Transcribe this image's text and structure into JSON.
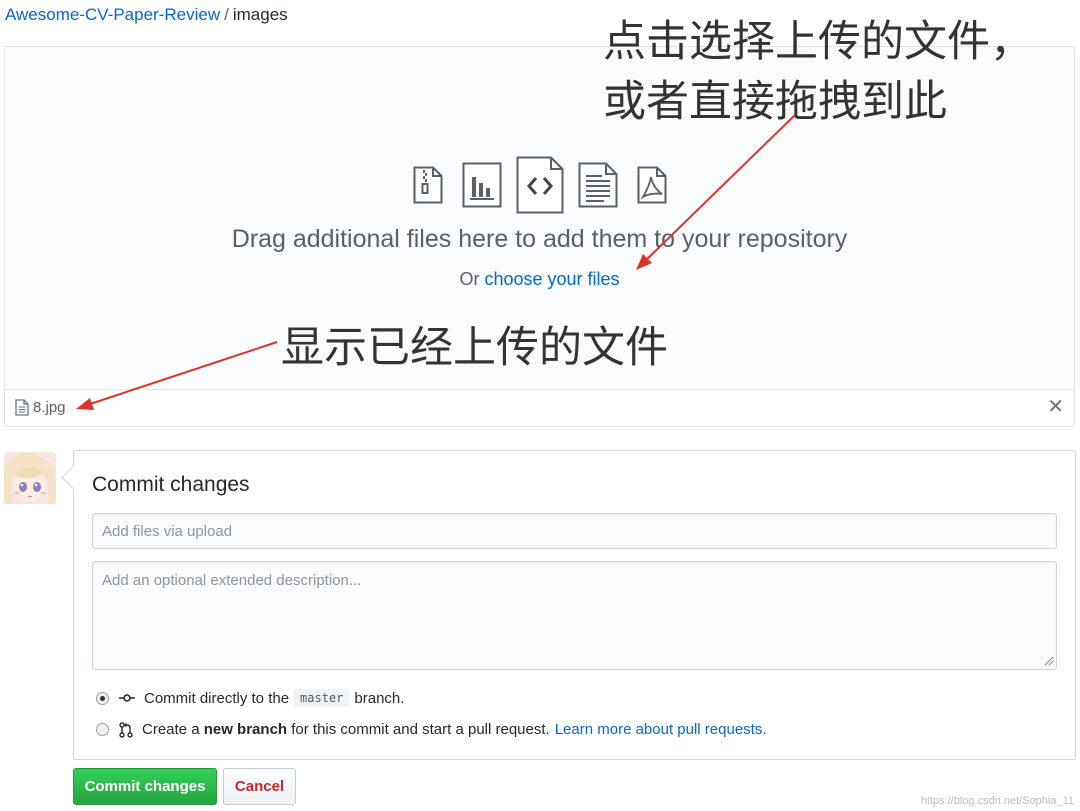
{
  "breadcrumb": {
    "repo": "Awesome-CV-Paper-Review",
    "separator": "/",
    "current": "images"
  },
  "dropzone": {
    "drag_text": "Drag additional files here to add them to your repository",
    "or_text": "Or",
    "choose_link": "choose your files",
    "file_icons": [
      "zip-file-icon",
      "chart-file-icon",
      "code-file-icon",
      "text-file-icon",
      "pdf-file-icon"
    ]
  },
  "uploaded_files": [
    {
      "name": "8.jpg"
    }
  ],
  "commit": {
    "title": "Commit changes",
    "summary_placeholder": "Add files via upload",
    "description_placeholder": "Add an optional extended description...",
    "option_direct": {
      "prefix": "Commit directly to the",
      "branch": "master",
      "suffix": "branch.",
      "selected": true
    },
    "option_new": {
      "prefix": "Create a",
      "bold": "new branch",
      "suffix": "for this commit and start a pull request.",
      "link": "Learn more about pull requests.",
      "selected": false
    },
    "commit_button": "Commit changes",
    "cancel_button": "Cancel"
  },
  "annotations": {
    "line1": "点击选择上传的文件，",
    "line2": "或者直接拖拽到此",
    "line3": "显示已经上传的文件",
    "arrow_color": "#e0322a"
  },
  "watermark": "https://blog.csdn.net/Sophia_11",
  "colors": {
    "link": "#0366d6",
    "primary_button": "#28a745",
    "danger_text": "#cb2431"
  }
}
